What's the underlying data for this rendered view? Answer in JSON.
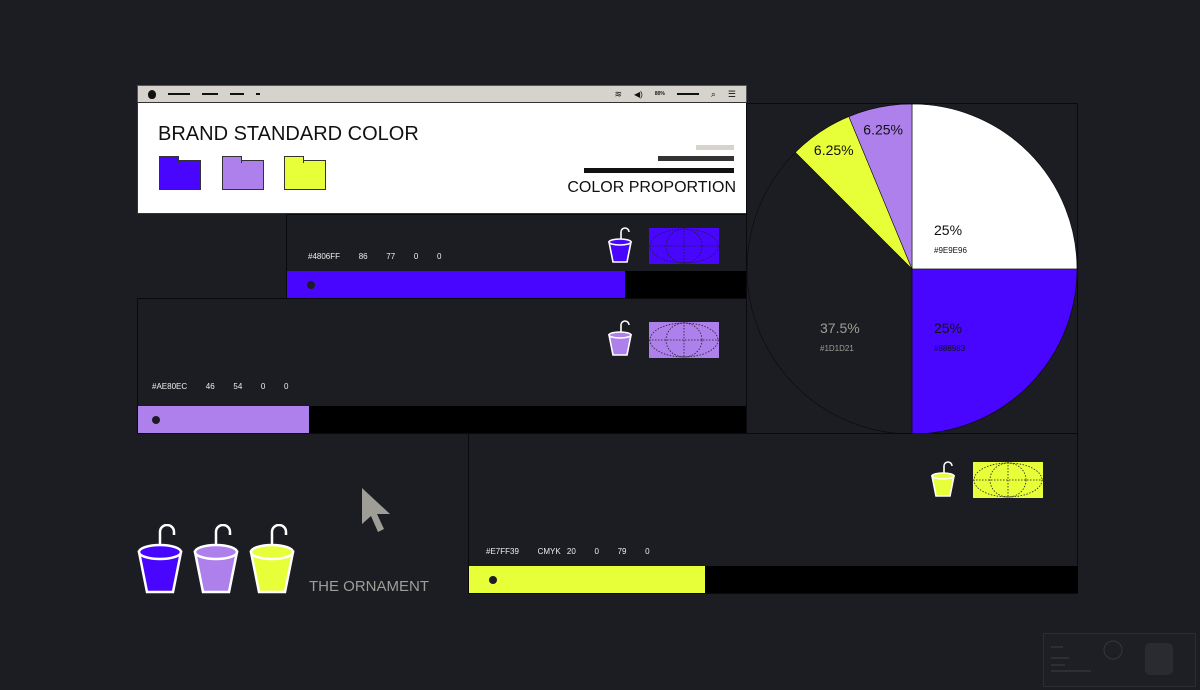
{
  "window": {
    "title": "BRAND STANDARD COLOR",
    "subtitle": "COLOR PROPORTION",
    "menubar": {
      "battery": "80%",
      "icons": [
        "apple-icon",
        "wifi-icon",
        "volume-icon",
        "battery-icon",
        "search-icon",
        "list-icon"
      ]
    },
    "folders": [
      "#4806FF",
      "#AE80EC",
      "#E7FF39"
    ]
  },
  "swatches": [
    {
      "code": "#4806FF   86   77   0   0",
      "color": "#4806FF",
      "bar_fill_percent": 73.5
    },
    {
      "code": "#AE80EC   46   54   0   0",
      "color": "#AE80EC",
      "bar_fill_percent": 28
    },
    {
      "code": "#E7FF39   CMYK 20   0   79   0",
      "color": "#E7FF39",
      "bar_fill_percent": 38.8
    }
  ],
  "ornament": {
    "label": "THE ORNAMENT",
    "buckets": [
      "#4806FF",
      "#AE80EC",
      "#E7FF39"
    ]
  },
  "chart_data": {
    "type": "pie",
    "start": "top",
    "direction": "clockwise",
    "slices": [
      {
        "label": "25%",
        "sub": "#9E9E96",
        "value": 25,
        "color": "#FFFFFF",
        "text": "#111111"
      },
      {
        "label": "25%",
        "sub": "#888983",
        "value": 25,
        "color": "#4806FF",
        "text": "#111111"
      },
      {
        "label": "37.5%",
        "sub": "#1D1D21",
        "value": 37.5,
        "color": "#1C1D22",
        "text": "#9e9e96"
      },
      {
        "label": "6.25%",
        "sub": "",
        "value": 6.25,
        "color": "#E7FF39",
        "text": "#111111"
      },
      {
        "label": "6.25%",
        "sub": "",
        "value": 6.25,
        "color": "#AE80EC",
        "text": "#111111"
      }
    ]
  }
}
